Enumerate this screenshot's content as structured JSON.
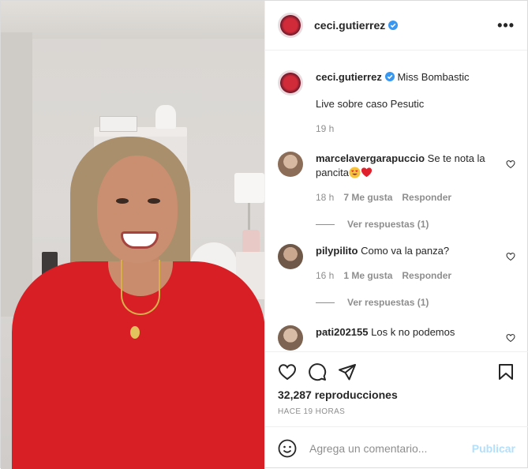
{
  "header": {
    "username": "ceci.gutierrez",
    "more_icon": "more-horizontal-icon"
  },
  "caption": {
    "username": "ceci.gutierrez",
    "text": "Miss Bombastic",
    "line2": "Live sobre caso Pesutic",
    "time": "19 h"
  },
  "comments": [
    {
      "username": "marcelavergarapuccio",
      "text": "Se te nota la pancita",
      "time": "18 h",
      "likes": "7 Me gusta",
      "reply": "Responder",
      "view_replies": "Ver respuestas (1)",
      "avatar_color": "#b79b86"
    },
    {
      "username": "pilypilito",
      "text": "Como va la panza?",
      "time": "16 h",
      "likes": "1 Me gusta",
      "reply": "Responder",
      "view_replies": "Ver respuestas (1)",
      "avatar_color": "#8a6f5b"
    },
    {
      "username": "pati202155",
      "text": "Los k no podemos",
      "avatar_color": "#a98a74"
    }
  ],
  "actions": {
    "views": "32,287 reproducciones",
    "ago": "HACE 19 HORAS"
  },
  "add_comment": {
    "placeholder": "Agrega un comentario...",
    "publish": "Publicar"
  },
  "colors": {
    "verified": "#3897f0",
    "publish_disabled": "#b2dffc",
    "muted": "#8e8e8e"
  }
}
